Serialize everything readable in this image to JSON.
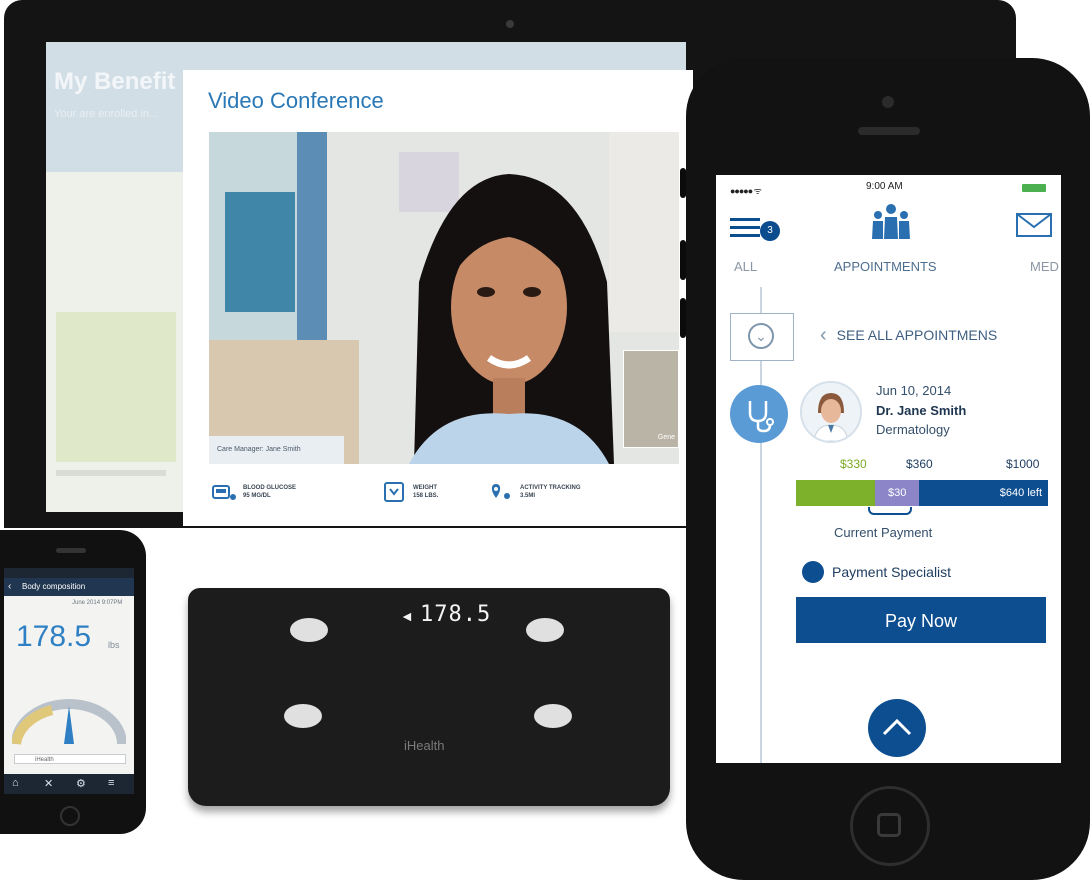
{
  "monitor": {
    "background_page": {
      "title": "My Benefit",
      "subtitle": "Your are enrolled in..."
    },
    "video_conference": {
      "title": "Video Conference",
      "caption": "Care Manager: Jane Smith",
      "pip_label": "Gene",
      "stats": [
        {
          "icon": "glucose-meter-icon",
          "line1": "BLOOD GLUCOSE",
          "line2": "95 MG/DL"
        },
        {
          "icon": "scale-icon",
          "line1": "WEIGHT",
          "line2": "158 LBS."
        },
        {
          "icon": "location-pin-icon",
          "line1": "ACTIVITY TRACKING",
          "line2": "3.5MI"
        }
      ]
    }
  },
  "big_phone": {
    "status_bar": {
      "signal": "●●●●● ᯤ",
      "time": "9:00 AM"
    },
    "badge_count": "3",
    "tabs": {
      "all": "ALL",
      "appointments": "APPOINTMENTS",
      "med": "MED"
    },
    "see_all": "SEE ALL APPOINTMENS",
    "appointment": {
      "date": "Jun 10, 2014",
      "doctor": "Dr. Jane Smith",
      "specialty": "Dermatology"
    },
    "payment": {
      "paid_label": "$330",
      "mid_label": "$360",
      "total_label": "$1000",
      "current_label": "$30",
      "left_label": "$640 left",
      "paid_fraction": 0.33,
      "current_fraction": 0.03,
      "current_payment_caption": "Current Payment"
    },
    "specialist_label": "Payment Specialist",
    "pay_button": "Pay Now"
  },
  "scale": {
    "display": "178.5",
    "brand": "iHealth"
  },
  "small_phone": {
    "header": "Body composition",
    "date": "June 2014 9:07PM",
    "weight": "178.5",
    "unit": "lbs",
    "search_text": "iHealth",
    "tab_icons": [
      "home-icon",
      "close-icon",
      "gear-icon",
      "list-icon"
    ]
  },
  "colors": {
    "brand_blue": "#0d4e91",
    "accent_green": "#7db12c",
    "light_blue": "#5b9bd5",
    "heading_blue": "#2a78b6"
  }
}
